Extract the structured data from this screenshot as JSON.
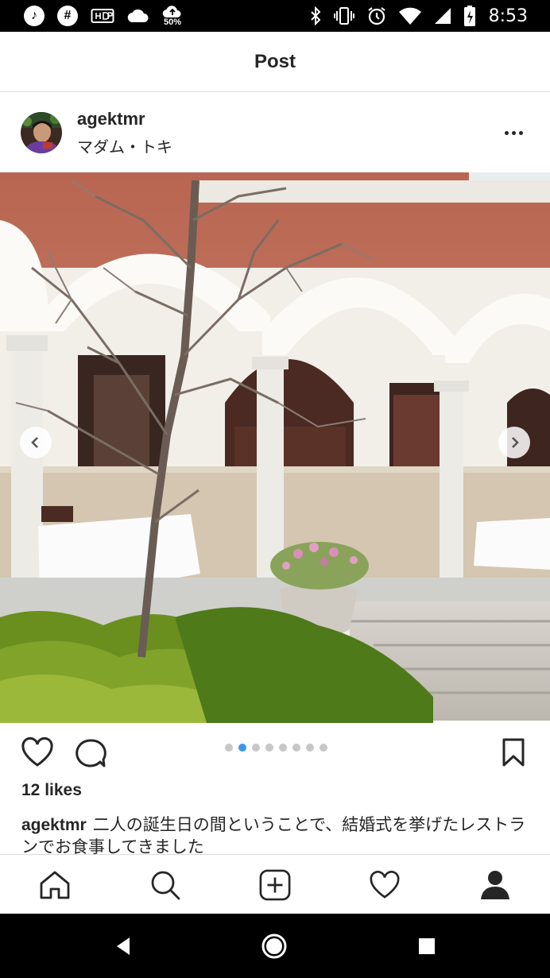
{
  "status_bar": {
    "time": "8:53",
    "left_icons": [
      "music-note-icon",
      "slack-icon",
      "hdr-icon",
      "cloud-icon",
      "cloud-upload-icon"
    ],
    "upload_label": "50%",
    "right_icons": [
      "bluetooth-icon",
      "vibrate-icon",
      "alarm-icon",
      "wifi-icon",
      "signal-icon",
      "battery-charging-icon"
    ]
  },
  "header": {
    "title": "Post"
  },
  "post": {
    "username": "agektmr",
    "location": "マダム・トキ",
    "more_icon": "more-horizontal-icon",
    "likes": "12 likes",
    "caption_user": "agektmr",
    "caption_text": "二人の誕生日の間ということで、結婚式を挙げたレストランでお食事してきました",
    "carousel": {
      "total": 8,
      "active_index": 1
    }
  },
  "tab_bar": {
    "items": [
      "home-icon",
      "search-icon",
      "new-post-icon",
      "activity-heart-icon",
      "profile-icon"
    ],
    "active": "profile-icon"
  },
  "nav_bar": {
    "items": [
      "back-icon",
      "home-icon",
      "recents-icon"
    ]
  },
  "colors": {
    "accent": "#3897f0",
    "text": "#262626",
    "divider": "#dbdbdb"
  }
}
